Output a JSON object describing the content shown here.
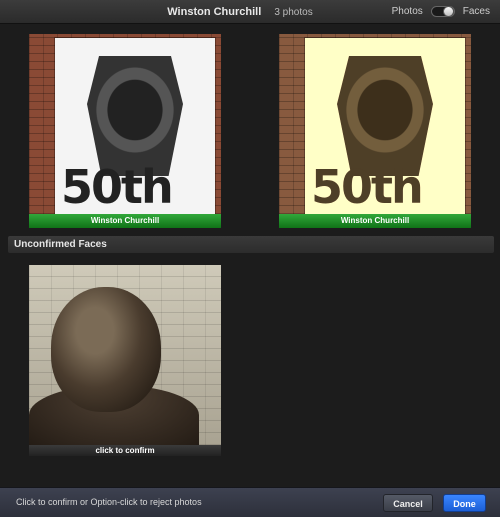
{
  "header": {
    "title": "Winston Churchill",
    "photo_count": "3 photos",
    "view_photos_label": "Photos",
    "view_faces_label": "Faces"
  },
  "confirmed_faces": [
    {
      "caption": "Winston Churchill",
      "banner_text": "50th"
    },
    {
      "caption": "Winston Churchill",
      "banner_text": "50th"
    }
  ],
  "unconfirmed_section": {
    "title": "Unconfirmed Faces",
    "faces": [
      {
        "caption": "click to confirm"
      }
    ]
  },
  "footer": {
    "hint": "Click to confirm or Option-click to reject photos",
    "cancel_label": "Cancel",
    "done_label": "Done"
  },
  "colors": {
    "confirmed_caption": "#1f8f28",
    "done_button": "#2a74ef"
  },
  "icons": {
    "view_toggle": "toggle-switch"
  }
}
